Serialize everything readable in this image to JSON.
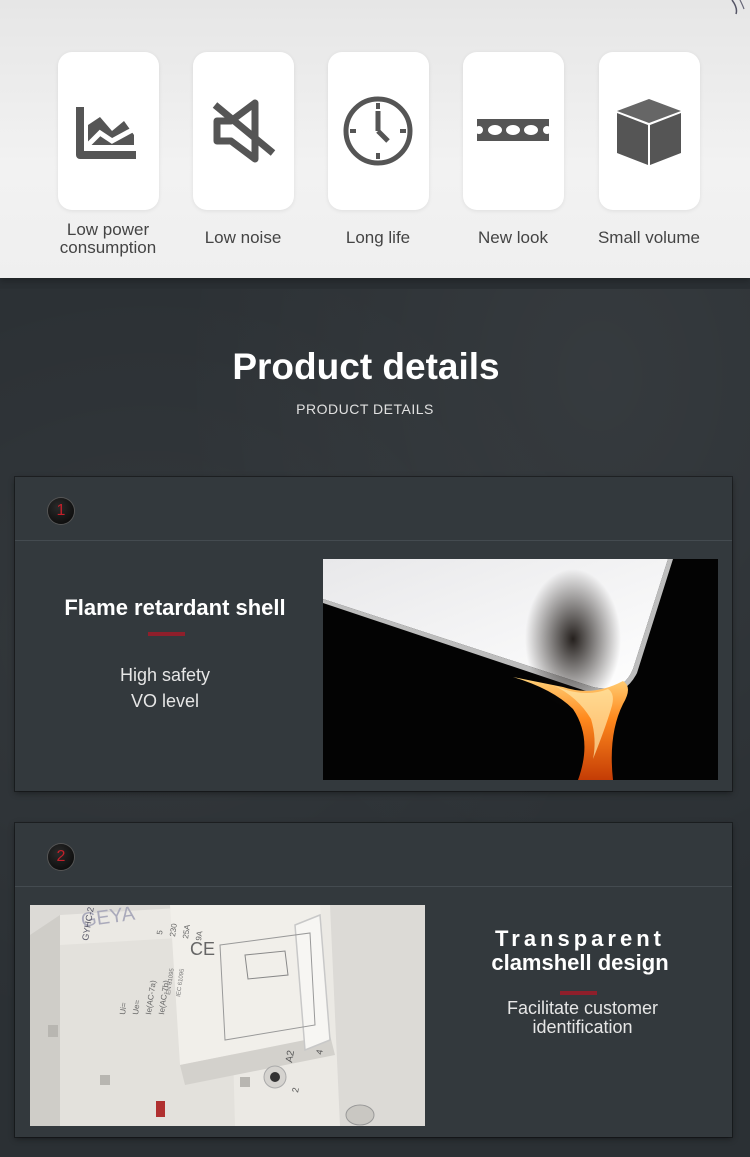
{
  "features": [
    {
      "icon": "low-power-chart-icon",
      "label_line1": "Low power",
      "label_line2": "consumption"
    },
    {
      "icon": "mute-speaker-icon",
      "label": "Low noise"
    },
    {
      "icon": "clock-icon",
      "label": "Long life"
    },
    {
      "icon": "rail-strip-icon",
      "label": "New look"
    },
    {
      "icon": "cube-icon",
      "label": "Small volume"
    }
  ],
  "section": {
    "title": "Product details",
    "subtitle": "PRODUCT DETAILS"
  },
  "details": [
    {
      "number": "1",
      "title": "Flame retardant shell",
      "lines": [
        "High safety",
        "VO level"
      ]
    },
    {
      "number": "2",
      "title_line1": "Transparent",
      "title_line2": "clamshell design",
      "lines": [
        "Facilitate customer",
        "identification"
      ]
    }
  ],
  "product_label": {
    "brand": "GEYA",
    "model": "GYHC-2",
    "ratings": [
      "Ui=",
      "Ue=",
      "Ie(AC-7a)",
      "Ie(AC-7b)"
    ],
    "values": [
      "5",
      "230",
      "25A",
      "9A"
    ],
    "standards": [
      "EN 61095",
      "IEC 61095"
    ],
    "terminals": [
      "A2",
      "4",
      "2"
    ],
    "cert": "CE"
  },
  "colors": {
    "accent_red": "#8f1f2b",
    "badge_number": "#c3202a",
    "icon_gray": "#555555",
    "panel_bg": "#33393d"
  }
}
